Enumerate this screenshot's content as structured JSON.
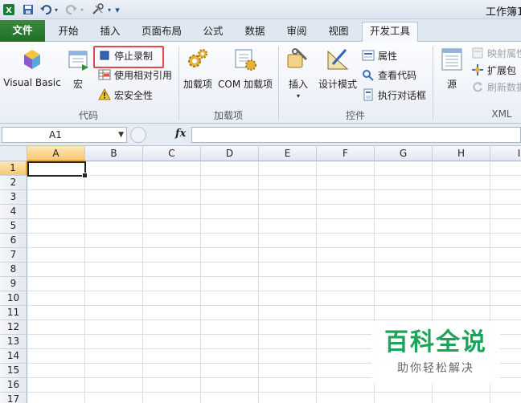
{
  "titlebar": {
    "title": "工作簿1"
  },
  "tabs": [
    {
      "label": "文件"
    },
    {
      "label": "开始"
    },
    {
      "label": "插入"
    },
    {
      "label": "页面布局"
    },
    {
      "label": "公式"
    },
    {
      "label": "数据"
    },
    {
      "label": "审阅"
    },
    {
      "label": "视图"
    },
    {
      "label": "开发工具"
    }
  ],
  "ribbon": {
    "code": {
      "label": "代码",
      "visual_basic": "Visual Basic",
      "macro": "宏",
      "stop_recording": "停止录制",
      "relative_ref": "使用相对引用",
      "macro_security": "宏安全性"
    },
    "addins": {
      "label": "加载项",
      "addins_btn": "加载项",
      "com_addins": "COM 加载项"
    },
    "controls": {
      "label": "控件",
      "insert": "插入",
      "design_mode": "设计模式",
      "properties": "属性",
      "view_code": "查看代码",
      "run_dialog": "执行对话框"
    },
    "xml": {
      "label": "XML",
      "source": "源",
      "map_props": "映射属性",
      "expansion": "扩展包",
      "refresh": "刷新数据"
    }
  },
  "formula_bar": {
    "name_box": "A1",
    "fx": "fx",
    "formula": ""
  },
  "sheet": {
    "columns": [
      "A",
      "B",
      "C",
      "D",
      "E",
      "F",
      "G",
      "H",
      "I"
    ],
    "rows": [
      "1",
      "2",
      "3",
      "4",
      "5",
      "6",
      "7",
      "8",
      "9",
      "10",
      "11",
      "12",
      "13",
      "14",
      "15",
      "16",
      "17"
    ]
  },
  "watermark": {
    "title": "百科全说",
    "subtitle": "助你轻松解决"
  }
}
